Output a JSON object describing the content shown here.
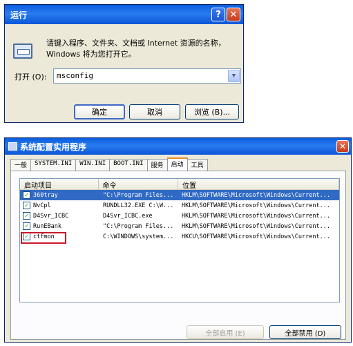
{
  "run_dialog": {
    "title": "运行",
    "help_glyph": "?",
    "close_glyph": "✕",
    "description": "请键入程序、文件夹、文档或 Internet 资源的名称，Windows 将为您打开它。",
    "open_label": "打开 (O):",
    "command_value": "msconfig",
    "dropdown_glyph": "▼",
    "ok_label": "确定",
    "cancel_label": "取消",
    "browse_label": "浏览 (B)..."
  },
  "msconfig": {
    "title": "系统配置实用程序",
    "close_glyph": "✕",
    "tabs": [
      "一般",
      "SYSTEM.INI",
      "WIN.INI",
      "BOOT.INI",
      "服务",
      "启动",
      "工具"
    ],
    "active_tab": "启动",
    "columns": [
      "启动项目",
      "命令",
      "位置"
    ],
    "rows": [
      {
        "checked": true,
        "item": "360tray",
        "command": "\"C:\\Program Files...",
        "location": "HKLM\\SOFTWARE\\Microsoft\\Windows\\Current..."
      },
      {
        "checked": true,
        "item": "NvCpl",
        "command": "RUNDLL32.EXE C:\\W...",
        "location": "HKLM\\SOFTWARE\\Microsoft\\Windows\\Current..."
      },
      {
        "checked": true,
        "item": "D4Svr_ICBC",
        "command": "D4Svr_ICBC.exe",
        "location": "HKLM\\SOFTWARE\\Microsoft\\Windows\\Current..."
      },
      {
        "checked": true,
        "item": "RunEBank",
        "command": "\"C:\\Program Files...",
        "location": "HKLM\\SOFTWARE\\Microsoft\\Windows\\Current..."
      },
      {
        "checked": true,
        "item": "ctfmon",
        "command": "C:\\WINDOWS\\system...",
        "location": "HKCU\\SOFTWARE\\Microsoft\\Windows\\Current..."
      }
    ],
    "enable_all_label": "全部启用 (E)",
    "disable_all_label": "全部禁用 (D)"
  },
  "colors": {
    "titlebar": "#0a5ddc",
    "dialog_bg": "#ece9d8",
    "selection": "#316ac5",
    "highlight_box": "#c8182a"
  },
  "icons": [
    "help-icon",
    "close-icon",
    "run-icon",
    "dropdown-arrow-icon",
    "msconfig-icon",
    "checkbox-icon"
  ]
}
